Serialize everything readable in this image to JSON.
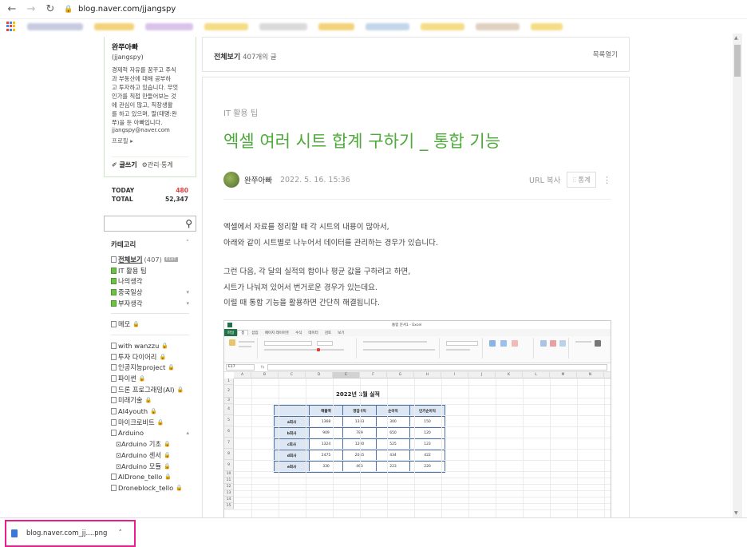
{
  "browser": {
    "url": "blog.naver.com/jjangspy",
    "back_icon": "arrow-left-icon",
    "forward_icon": "arrow-right-icon",
    "reload_icon": "reload-icon"
  },
  "profile": {
    "nickname": "완쭈아빠",
    "blog_id": "(jjangspy)",
    "intro_lines": [
      "경제적 자유를 꿈꾸고 주식",
      "과 부동산에 대해 공부하",
      "고 투자하고 있습니다. 무엇",
      "인가를 직접 만들어보는 것",
      "에 관심이 많고, 직장생활",
      "를 하고 있으며, 딸(태명:완",
      "쭈)을 둔 아빠입니다."
    ],
    "email": "jjangspy@naver.com",
    "profile_link": "프로필 ▸",
    "write_label": "✐ 글쓰기",
    "manage_label": "⚙관리·통계"
  },
  "stats": {
    "today_label": "TODAY",
    "today_value": "480",
    "total_label": "TOTAL",
    "total_value": "52,347"
  },
  "categories": {
    "header": "카테고리",
    "all": "전체보기",
    "all_count": "(407)",
    "edit_badge": "EDIT",
    "group1": [
      "IT 활용 팁",
      "나의생각",
      "중국일상",
      "부자생각"
    ],
    "memo": "메모",
    "group2": [
      "with wanzzu",
      "투자 다이어리",
      "인공지능project",
      "파이썬",
      "드론 프로그래밍(AI)",
      "미래기술",
      "AI4youth",
      "마이크로비트",
      "Arduino"
    ],
    "arduino_sub": [
      "Arduino 기초",
      "Arduino 센서",
      "Arduino 모듈"
    ],
    "group3": [
      "AIDrone_tello",
      "Droneblock_tello"
    ]
  },
  "topbar": {
    "all_view": "전체보기",
    "post_count": "407개의 글",
    "list_open": "목록열기"
  },
  "post": {
    "category": "IT 활용 팁",
    "title": "엑셀 여러 시트 합계 구하기 _ 통합 기능",
    "author": "완쭈아빠",
    "date": "2022. 5. 16. 15:36",
    "url_copy": "URL 복사",
    "stat_btn": "⫶⫶ 통계",
    "paragraph1": [
      "엑셀에서 자료를 정리할 때 각 시트의 내용이 많아서,",
      "아래와 같이 시트별로 나누어서 데이터를 관리하는 경우가 있습니다."
    ],
    "paragraph2": [
      "그런 다음, 각 달의 실적의 합이나 평균 값을 구하려고 하면,",
      "시트가 나눠져 있어서 번거로운 경우가 있는데요.",
      "이럴 때 통합 기능을 활용하면 간단히 해결됩니다."
    ]
  },
  "excel": {
    "window_title": "통합 문서1 - Excel",
    "tabs": [
      "파일",
      "홈",
      "삽입",
      "페이지 레이아웃",
      "수식",
      "데이터",
      "검토",
      "보기"
    ],
    "namebox": "E17",
    "fx": "fx",
    "columns": [
      "A",
      "B",
      "C",
      "D",
      "E",
      "F",
      "G",
      "H",
      "I",
      "J",
      "K",
      "L",
      "M",
      "N",
      "O"
    ],
    "rows": [
      "1",
      "2",
      "3",
      "4",
      "5",
      "6",
      "7",
      "8",
      "9",
      "10",
      "11",
      "12",
      "13",
      "14",
      "15"
    ],
    "sheet_title": "2022년 1월 실적",
    "table_headers": [
      "",
      "매출액",
      "영업이익",
      "순이익",
      "단기순이익"
    ],
    "table_rows": [
      [
        "a회사",
        "1368",
        "1333",
        "300",
        "150"
      ],
      [
        "b회사",
        "909",
        "789",
        "650",
        "120"
      ],
      [
        "c회사",
        "1324",
        "1200",
        "525",
        "123"
      ],
      [
        "d회사",
        "2475",
        "2055",
        "434",
        "422"
      ],
      [
        "e회사",
        "330",
        "463",
        "223",
        "220"
      ]
    ]
  },
  "download": {
    "filename": "blog.naver.com_jj....png"
  }
}
